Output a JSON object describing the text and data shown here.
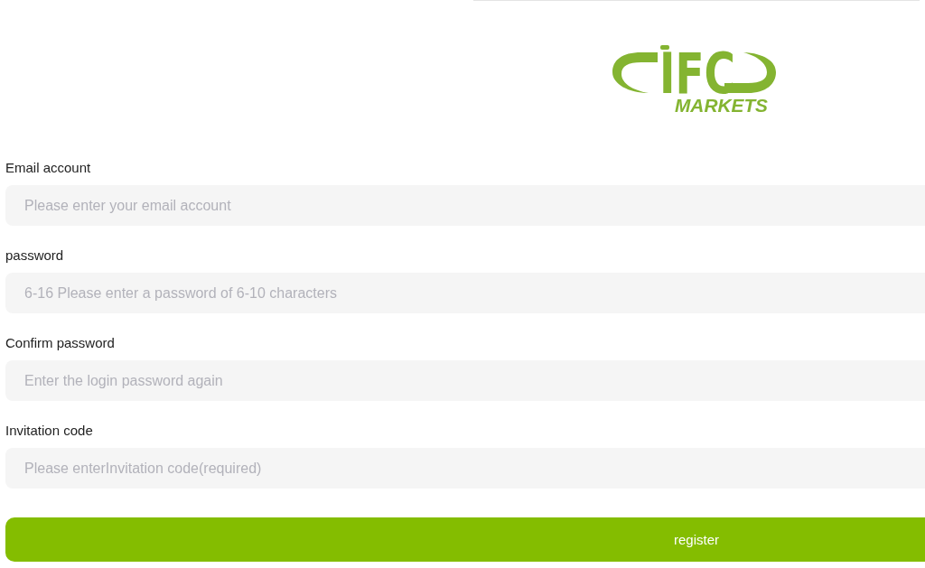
{
  "logo": {
    "wordmark": "IFC",
    "tagline": "MARKETS"
  },
  "fields": [
    {
      "label": "Email account",
      "placeholder": "Please enter your email account"
    },
    {
      "label": "password",
      "placeholder": "6-16 Please enter a password of 6-10 characters"
    },
    {
      "label": "Confirm password",
      "placeholder": "Enter the login password again"
    },
    {
      "label": "Invitation code",
      "placeholder": "Please enterInvitation code(required)"
    }
  ],
  "submit": {
    "label": "register"
  }
}
